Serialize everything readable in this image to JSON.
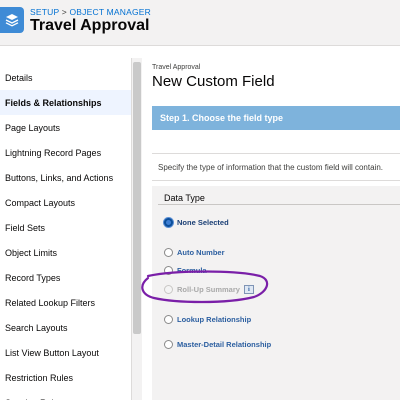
{
  "header": {
    "breadcrumb_setup": "SETUP",
    "breadcrumb_sep": " > ",
    "breadcrumb_object_manager": "OBJECT MANAGER",
    "title": "Travel Approval"
  },
  "sidebar": {
    "items": [
      {
        "label": "Details"
      },
      {
        "label": "Fields & Relationships"
      },
      {
        "label": "Page Layouts"
      },
      {
        "label": "Lightning Record Pages"
      },
      {
        "label": "Buttons, Links, and Actions"
      },
      {
        "label": "Compact Layouts"
      },
      {
        "label": "Field Sets"
      },
      {
        "label": "Object Limits"
      },
      {
        "label": "Record Types"
      },
      {
        "label": "Related Lookup Filters"
      },
      {
        "label": "Search Layouts"
      },
      {
        "label": "List View Button Layout"
      },
      {
        "label": "Restriction Rules"
      },
      {
        "label": "Scoping Rules"
      }
    ],
    "active_index": 1
  },
  "main": {
    "object_label": "Travel Approval",
    "page_title": "New Custom Field",
    "step_title": "Step 1. Choose the field type",
    "description": "Specify the type of information that the custom field will contain.",
    "section_title": "Data Type",
    "options": [
      {
        "label": "None Selected",
        "state": "checked"
      },
      {
        "label": "Auto Number",
        "state": "normal"
      },
      {
        "label": "Formula",
        "state": "normal"
      },
      {
        "label": "Roll-Up Summary",
        "state": "disabled",
        "info": "i"
      },
      {
        "label": "Lookup Relationship",
        "state": "normal"
      },
      {
        "label": "Master-Detail Relationship",
        "state": "normal"
      }
    ]
  },
  "colors": {
    "accent": "#0070d2",
    "step_bar": "#7eb3dc",
    "annotation": "#7a1fa8"
  },
  "icons": {
    "app": "layers-icon",
    "info": "info-icon"
  }
}
